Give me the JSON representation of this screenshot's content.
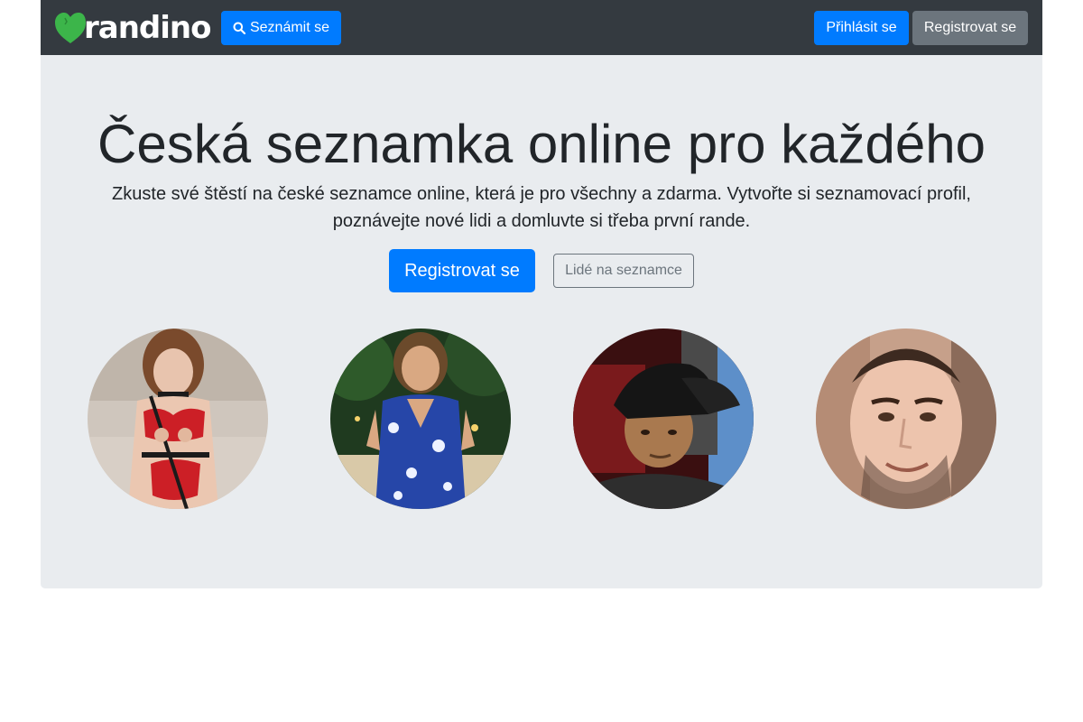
{
  "navbar": {
    "brand": "randino",
    "search_button": "Seznámit se",
    "login_button": "Přihlásit se",
    "register_button": "Registrovat se"
  },
  "hero": {
    "title": "Česká seznamka online pro každého",
    "lead": "Zkuste své štěstí na české seznamce online, která je pro všechny a zdarma. Vytvořte si seznamovací profil, poznávejte nové lidi a domluvte si třeba první rande.",
    "register_button": "Registrovat se",
    "people_button": "Lidé na seznamce"
  },
  "profiles": [
    {
      "photo": "profile-photo-woman-red-lingerie"
    },
    {
      "photo": "profile-photo-woman-blue-dress"
    },
    {
      "photo": "profile-photo-man-black-cap"
    },
    {
      "photo": "profile-photo-man-selfie"
    }
  ],
  "colors": {
    "navbar_bg": "#343a40",
    "primary": "#007bff",
    "secondary": "#6c757d",
    "jumbotron_bg": "#e9ecef",
    "logo_green": "#3cb54a"
  }
}
